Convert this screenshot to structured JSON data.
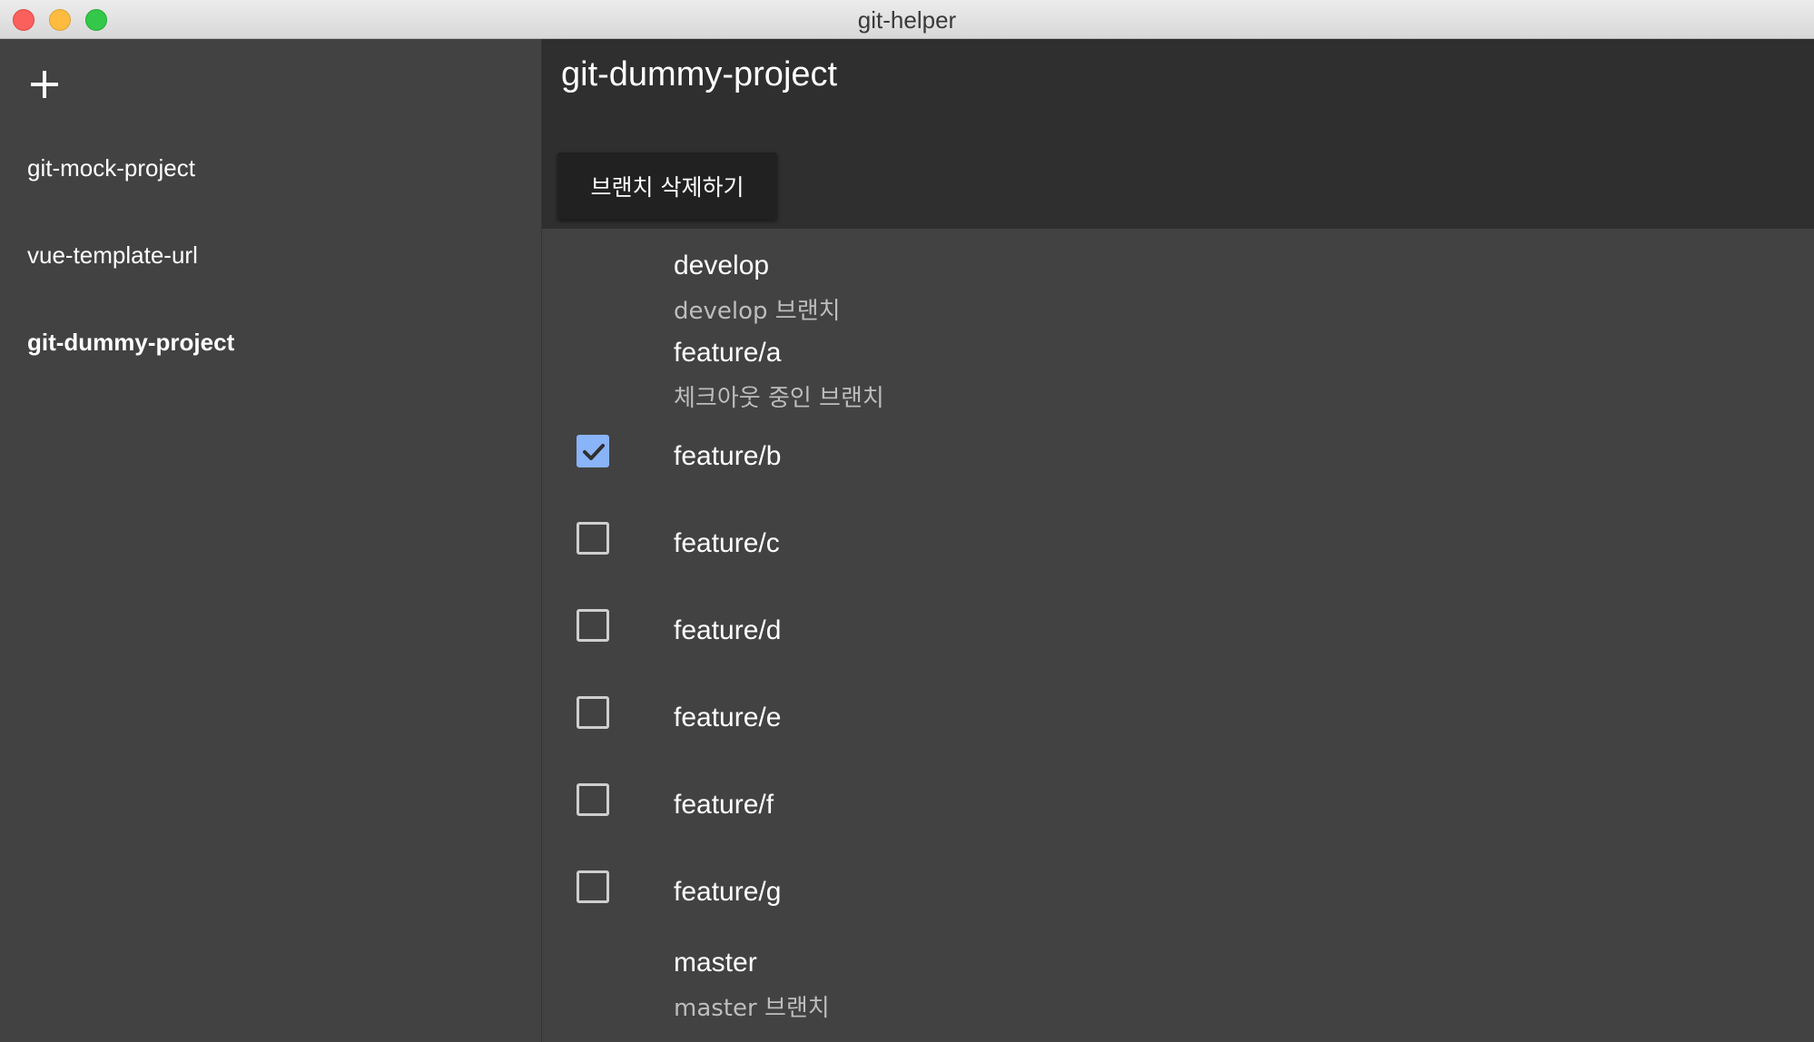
{
  "window": {
    "title": "git-helper"
  },
  "sidebar": {
    "add_icon": "plus-icon",
    "projects": [
      {
        "name": "git-mock-project",
        "active": false
      },
      {
        "name": "vue-template-url",
        "active": false
      },
      {
        "name": "git-dummy-project",
        "active": true
      }
    ]
  },
  "main": {
    "title": "git-dummy-project",
    "delete_button_label": "브랜치 삭제하기",
    "branches": [
      {
        "name": "develop",
        "subtitle": "develop 브랜치",
        "selectable": false
      },
      {
        "name": "feature/a",
        "subtitle": "체크아웃 중인 브랜치",
        "selectable": false
      },
      {
        "name": "feature/b",
        "selectable": true,
        "checked": true
      },
      {
        "name": "feature/c",
        "selectable": true,
        "checked": false
      },
      {
        "name": "feature/d",
        "selectable": true,
        "checked": false
      },
      {
        "name": "feature/e",
        "selectable": true,
        "checked": false
      },
      {
        "name": "feature/f",
        "selectable": true,
        "checked": false
      },
      {
        "name": "feature/g",
        "selectable": true,
        "checked": false
      },
      {
        "name": "master",
        "subtitle": "master 브랜치",
        "selectable": false
      }
    ]
  },
  "colors": {
    "background": "#424242",
    "header": "#2f2f2f",
    "button": "#212121",
    "checkbox_checked": "#8ab4f8"
  }
}
